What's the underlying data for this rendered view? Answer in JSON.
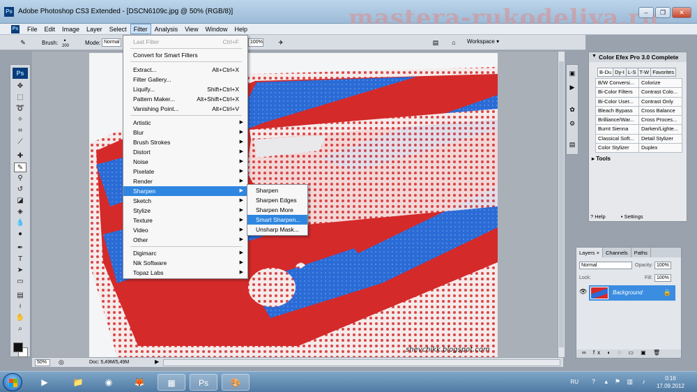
{
  "window": {
    "title": "Adobe Photoshop CS3 Extended - [DSCN6109c.jpg @ 50% (RGB/8)]",
    "app_icon": "Ps",
    "watermark": "mastera-rukodeliya.ru"
  },
  "menubar": {
    "items": [
      "File",
      "Edit",
      "Image",
      "Layer",
      "Select",
      "Filter",
      "Analysis",
      "View",
      "Window",
      "Help"
    ],
    "active": "Filter"
  },
  "options": {
    "brush_label": "Brush:",
    "brush_size": "200",
    "mode_label": "Mode:",
    "mode_value": "Normal",
    "flow_value": "100%",
    "workspace_label": "Workspace"
  },
  "filter_menu": {
    "last_filter": {
      "label": "Last Filter",
      "shortcut": "Ctrl+F"
    },
    "convert": "Convert for Smart Filters",
    "group1": [
      {
        "label": "Extract...",
        "shortcut": "Alt+Ctrl+X"
      },
      {
        "label": "Filter Gallery...",
        "shortcut": ""
      },
      {
        "label": "Liquify...",
        "shortcut": "Shift+Ctrl+X"
      },
      {
        "label": "Pattern Maker...",
        "shortcut": "Alt+Shift+Ctrl+X"
      },
      {
        "label": "Vanishing Point...",
        "shortcut": "Alt+Ctrl+V"
      }
    ],
    "group2": [
      "Artistic",
      "Blur",
      "Brush Strokes",
      "Distort",
      "Noise",
      "Pixelate",
      "Render",
      "Sharpen",
      "Sketch",
      "Stylize",
      "Texture",
      "Video",
      "Other"
    ],
    "group3": [
      "Digimarc",
      "Nik Software",
      "Topaz Labs"
    ],
    "highlighted": "Sharpen"
  },
  "sharpen_submenu": {
    "items": [
      "Sharpen",
      "Sharpen Edges",
      "Sharpen More",
      "Smart Sharpen...",
      "Unsharp Mask..."
    ],
    "highlighted": "Smart Sharpen..."
  },
  "canvas": {
    "blog_tag": "shevchikk.blogspot.com",
    "colors": {
      "red": "#d42a2a",
      "blue": "#2a6bd6",
      "white_print": "#f3e4e4"
    }
  },
  "status": {
    "zoom": "50%",
    "doc": "Doc: 5,49M/5,49M"
  },
  "color_efex": {
    "title": "Color Efex Pro 3.0 Complete",
    "tabs": [
      "B-Du",
      "Dy-I",
      "L-S",
      "T-W",
      "Favorites"
    ],
    "filters": [
      [
        "B/W Conversi...",
        "Colorize"
      ],
      [
        "Bi-Color Filters",
        "Contrast Colo..."
      ],
      [
        "Bi-Color User...",
        "Contrast Only"
      ],
      [
        "Bleach Bypass",
        "Cross Balance"
      ],
      [
        "Brilliance/War...",
        "Cross Proces..."
      ],
      [
        "Burnt Sienna",
        "Darken/Lighte..."
      ],
      [
        "Classical Soft...",
        "Detail Stylizer"
      ],
      [
        "Color Stylizer",
        "Duplex"
      ]
    ],
    "tools_label": "Tools",
    "help_label": "Help",
    "settings_label": "Settings"
  },
  "layers_panel": {
    "tabs": [
      "Layers",
      "Channels",
      "Paths"
    ],
    "blend_mode": "Normal",
    "opacity_label": "Opacity:",
    "opacity_value": "100%",
    "lock_label": "Lock:",
    "fill_label": "Fill:",
    "fill_value": "100%",
    "layer_name": "Background"
  },
  "taskbar": {
    "language": "RU",
    "time": "0:16",
    "date": "17.09.2012"
  }
}
